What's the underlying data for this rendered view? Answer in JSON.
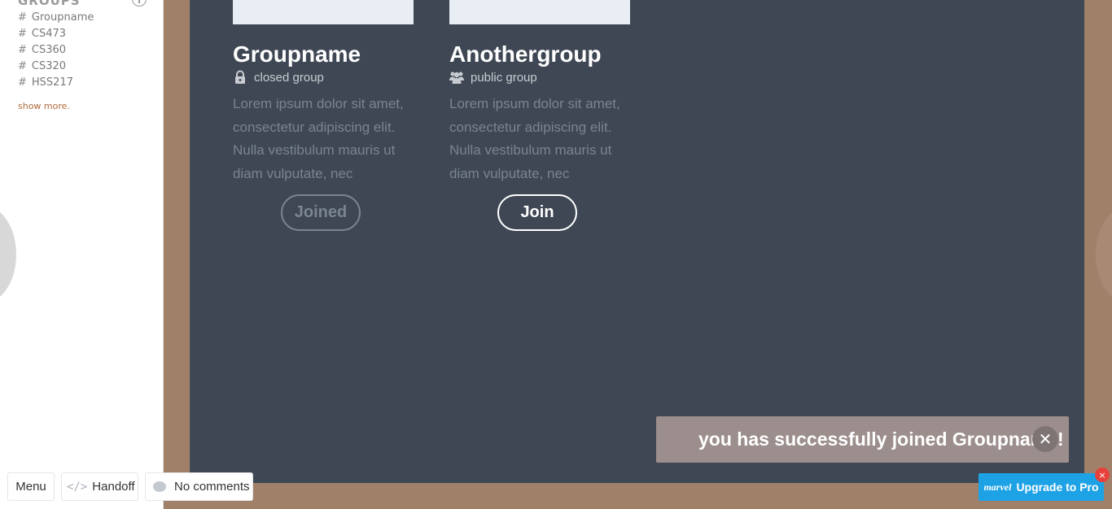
{
  "sidebar": {
    "heading": "GROUPS",
    "groups": [
      "Groupname",
      "CS473",
      "CS360",
      "CS320",
      "HSS217"
    ],
    "hash": "#",
    "show_more": "show more."
  },
  "cards": [
    {
      "title": "Groupname",
      "type": "closed group",
      "type_icon": "lock-icon",
      "desc_lines": [
        "Lorem ipsum dolor sit amet,",
        "consectetur adipiscing elit.",
        "Nulla vestibulum mauris ut",
        "diam vulputate, nec"
      ],
      "button": "Joined"
    },
    {
      "title": "Anothergroup",
      "type": "public group",
      "type_icon": "users-icon",
      "desc_lines": [
        "Lorem ipsum dolor sit amet,",
        "consectetur adipiscing elit.",
        "Nulla vestibulum mauris ut",
        "diam vulputate, nec"
      ],
      "button": "Join"
    }
  ],
  "toast": {
    "message": "you has successfully joined Groupname!",
    "close": "✕"
  },
  "toolbar": {
    "menu": "Menu",
    "handoff": "Handoff",
    "handoff_icon": "</>",
    "comments": "No comments"
  },
  "upgrade": {
    "logo": "marvel",
    "label": "Upgrade to Pro",
    "close": "×"
  },
  "colors": {
    "screen_bg": "#3e4753",
    "frame_bg": "#a08068",
    "toast_bg": "#9c8e8c",
    "upgrade_bg": "#1ea2e6"
  }
}
